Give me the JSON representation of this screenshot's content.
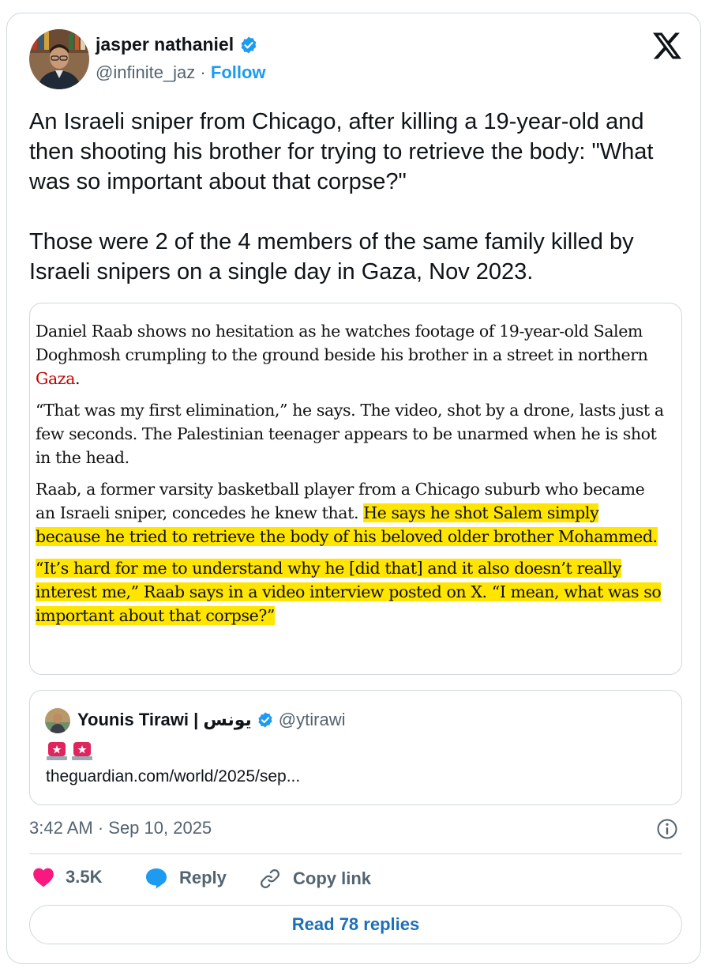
{
  "author": {
    "name": "jasper nathaniel",
    "handle": "@infinite_jaz",
    "separator": "·",
    "follow_label": "Follow"
  },
  "tweet": {
    "text": "An Israeli sniper from Chicago, after killing a 19-year-old and then shooting his brother for trying to retrieve the body: \"What was so important about that corpse?\"\n\nThose were 2 of the 4 members of the same family killed by Israeli snipers on a single day in Gaza, Nov 2023."
  },
  "article_image": {
    "p1_before": "Daniel Raab shows no hesitation as he watches footage of 19-year-old Salem Doghmosh crumpling to the ground beside his brother in a street in northern ",
    "p1_link": "Gaza",
    "p1_after": ".",
    "p2": "“That was my first elimination,” he says. The video, shot by a drone, lasts just a few seconds. The Palestinian teenager appears to be unarmed when he is shot in the head.",
    "p3_plain": "Raab, a former varsity basketball player from a Chicago suburb who became an Israeli sniper, concedes he knew that. ",
    "p3_highlight": "He says he shot Salem simply because he tried to retrieve the body of his beloved older brother Mohammed.",
    "p4_highlight": "“It’s hard for me to understand why he [did that] and it also doesn’t really interest me,” Raab says in a video interview posted on X. “I mean, what was so important about that corpse?”",
    "link_color": "#c70000",
    "highlight_color": "#ffe500"
  },
  "quoted": {
    "name": "Younis Tirawi | يونس",
    "handle": "@ytirawi",
    "emoji": "🚨🚨",
    "link": "theguardian.com/world/2025/sep..."
  },
  "meta": {
    "timestamp": "3:42 AM · Sep 10, 2025"
  },
  "actions": {
    "likes": "3.5K",
    "reply_label": "Reply",
    "copy_label": "Copy link",
    "read_replies_label": "Read 78 replies"
  },
  "colors": {
    "accent": "#1d9bf0",
    "like": "#f91880",
    "muted": "#536471",
    "border": "#cfd9de"
  },
  "icons": [
    "verified-badge-icon",
    "x-logo-icon",
    "info-icon",
    "heart-icon",
    "reply-bubble-icon",
    "link-icon",
    "siren-icon"
  ]
}
